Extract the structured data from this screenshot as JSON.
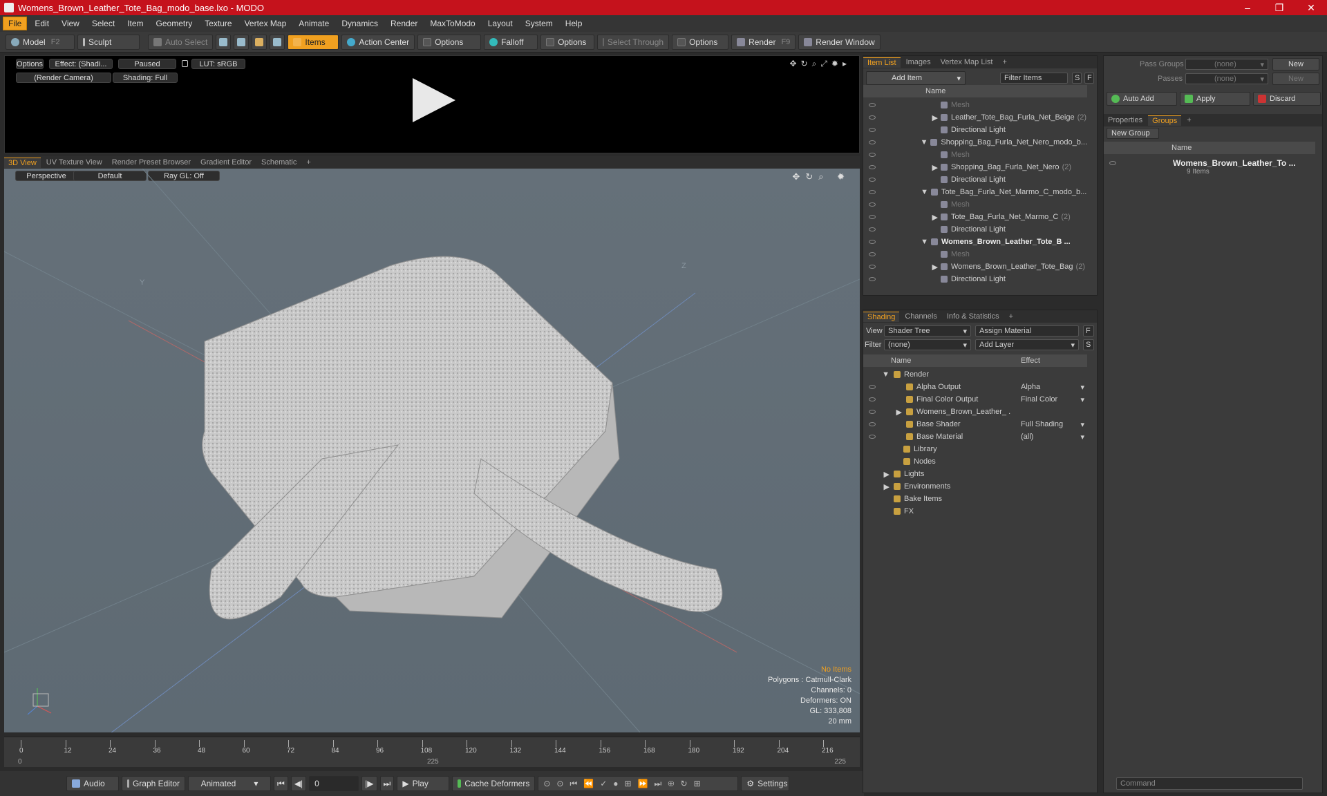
{
  "window": {
    "title": "Womens_Brown_Leather_Tote_Bag_modo_base.lxo - MODO",
    "minimize": "–",
    "maximize": "❐",
    "close": "✕"
  },
  "menu": [
    "File",
    "Edit",
    "View",
    "Select",
    "Item",
    "Geometry",
    "Texture",
    "Vertex Map",
    "Animate",
    "Dynamics",
    "Render",
    "MaxToModo",
    "Layout",
    "System",
    "Help"
  ],
  "toolbar": {
    "model": "Model",
    "model_key": "F2",
    "sculpt": "Sculpt",
    "auto_select": "Auto Select",
    "items": "Items",
    "action_center": "Action Center",
    "options1": "Options",
    "falloff": "Falloff",
    "options2": "Options",
    "select_through": "Select Through",
    "options3": "Options",
    "render": "Render",
    "render_key": "F9",
    "render_window": "Render Window"
  },
  "viewer": {
    "options": "Options",
    "effect": "Effect: (Shadi...",
    "paused": "Paused",
    "lut": "LUT: sRGB",
    "camera": "(Render Camera)",
    "shading": "Shading: Full"
  },
  "viewtabs": [
    "3D View",
    "UV Texture View",
    "Render Preset Browser",
    "Gradient Editor",
    "Schematic",
    "+"
  ],
  "viewport": {
    "perspective": "Perspective",
    "default": "Default",
    "raygl": "Ray GL: Off",
    "axis_y": "Y",
    "axis_z": "Z",
    "stats": {
      "no_items": "No Items",
      "polygons": "Polygons : Catmull-Clark",
      "channels": "Channels: 0",
      "deformers": "Deformers: ON",
      "gl": "GL: 333,808",
      "scale": "20 mm"
    }
  },
  "timeline": {
    "ticks": [
      "0",
      "12",
      "24",
      "36",
      "48",
      "60",
      "72",
      "84",
      "96",
      "108",
      "120",
      "132",
      "144",
      "156",
      "168",
      "180",
      "192",
      "204",
      "216"
    ],
    "start": "0",
    "mid": "225",
    "end": "225"
  },
  "bottombar": {
    "audio": "Audio",
    "graph_editor": "Graph Editor",
    "animated": "Animated",
    "frame": "0",
    "play": "Play",
    "cache": "Cache Deformers",
    "settings": "Settings"
  },
  "itemlist": {
    "tabs": [
      "Item List",
      "Images",
      "Vertex Map List",
      "+"
    ],
    "add_item": "Add Item",
    "filter": "Filter Items",
    "s": "S",
    "f": "F",
    "col_name": "Name",
    "rows": [
      {
        "indent": 2,
        "text": "Mesh",
        "dim": true,
        "arrow": ""
      },
      {
        "indent": 2,
        "text": "Leather_Tote_Bag_Furla_Net_Beige",
        "count": "(2)",
        "arrow": "▶"
      },
      {
        "indent": 2,
        "text": "Directional Light",
        "arrow": ""
      },
      {
        "indent": 1,
        "text": "Shopping_Bag_Furla_Net_Nero_modo_b...",
        "arrow": "▼"
      },
      {
        "indent": 2,
        "text": "Mesh",
        "dim": true,
        "arrow": ""
      },
      {
        "indent": 2,
        "text": "Shopping_Bag_Furla_Net_Nero",
        "count": "(2)",
        "arrow": "▶"
      },
      {
        "indent": 2,
        "text": "Directional Light",
        "arrow": ""
      },
      {
        "indent": 1,
        "text": "Tote_Bag_Furla_Net_Marmo_C_modo_b...",
        "arrow": "▼"
      },
      {
        "indent": 2,
        "text": "Mesh",
        "dim": true,
        "arrow": ""
      },
      {
        "indent": 2,
        "text": "Tote_Bag_Furla_Net_Marmo_C",
        "count": "(2)",
        "arrow": "▶"
      },
      {
        "indent": 2,
        "text": "Directional Light",
        "arrow": ""
      },
      {
        "indent": 1,
        "text": "Womens_Brown_Leather_Tote_B ...",
        "bold": true,
        "arrow": "▼"
      },
      {
        "indent": 2,
        "text": "Mesh",
        "dim": true,
        "arrow": ""
      },
      {
        "indent": 2,
        "text": "Womens_Brown_Leather_Tote_Bag",
        "count": "(2)",
        "arrow": "▶"
      },
      {
        "indent": 2,
        "text": "Directional Light",
        "arrow": ""
      }
    ]
  },
  "shading": {
    "tabs": [
      "Shading",
      "Channels",
      "Info & Statistics",
      "+"
    ],
    "view_label": "View",
    "view_value": "Shader Tree",
    "assign": "Assign Material",
    "filter_label": "Filter",
    "filter_value": "(none)",
    "add_layer": "Add Layer",
    "f": "F",
    "s": "S",
    "col_name": "Name",
    "col_effect": "Effect",
    "rows": [
      {
        "indent": 0,
        "text": "Render",
        "effect": "",
        "arrow": "▼",
        "eye": false
      },
      {
        "indent": 1,
        "text": "Alpha Output",
        "effect": "Alpha",
        "eye": true
      },
      {
        "indent": 1,
        "text": "Final Color Output",
        "effect": "Final Color",
        "eye": true
      },
      {
        "indent": 1,
        "text": "Womens_Brown_Leather_ ...",
        "effect": "",
        "arrow": "▶",
        "eye": true
      },
      {
        "indent": 1,
        "text": "Base Shader",
        "effect": "Full Shading",
        "eye": true
      },
      {
        "indent": 1,
        "text": "Base Material",
        "effect": "(all)",
        "eye": true
      },
      {
        "indent": 1,
        "text": "Library",
        "effect": "",
        "eye": false
      },
      {
        "indent": 1,
        "text": "Nodes",
        "effect": "",
        "eye": false
      },
      {
        "indent": 0,
        "text": "Lights",
        "effect": "",
        "arrow": "▶",
        "eye": false
      },
      {
        "indent": 0,
        "text": "Environments",
        "effect": "",
        "arrow": "▶",
        "eye": false
      },
      {
        "indent": 0,
        "text": "Bake Items",
        "effect": "",
        "eye": false
      },
      {
        "indent": 0,
        "text": "FX",
        "effect": "",
        "eye": false
      }
    ]
  },
  "groups": {
    "pass_groups": "Pass Groups",
    "passes": "Passes",
    "none1": "(none)",
    "none2": "(none)",
    "new1": "New",
    "new2": "New",
    "auto_add": "Auto Add",
    "apply": "Apply",
    "discard": "Discard",
    "tabs": [
      "Properties",
      "Groups",
      "+"
    ],
    "new_group": "New Group",
    "col_name": "Name",
    "group_name": "Womens_Brown_Leather_To ...",
    "group_count": "9 Items"
  },
  "command": {
    "placeholder": "Command"
  }
}
